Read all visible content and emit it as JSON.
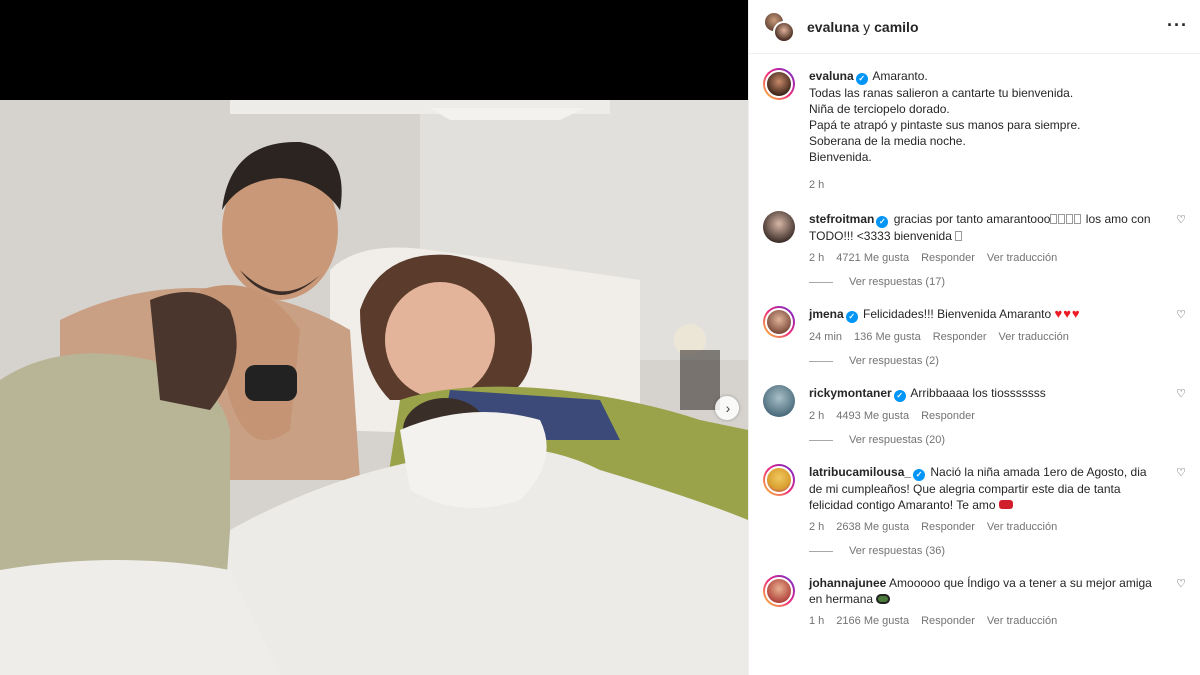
{
  "header": {
    "account_1": "evaluna",
    "joiner": "y",
    "account_2": "camilo"
  },
  "caption": {
    "username": "evaluna",
    "lines": [
      "Amaranto.",
      "Todas las ranas salieron a cantarte tu bienvenida.",
      "Niña de terciopelo dorado.",
      "Papá te atrapó y pintaste sus manos para siempre.",
      "Soberana de la media noche.",
      "Bienvenida."
    ],
    "time": "2 h"
  },
  "labels": {
    "reply": "Responder",
    "translate": "Ver traducción",
    "likes_suffix": "Me gusta"
  },
  "comments": [
    {
      "username": "stefroitman",
      "text": "gracias por tanto amarantooo",
      "text_2": "los amo con TODO!!! <3333 bienvenida",
      "time": "2 h",
      "likes": "4721",
      "replies": "Ver respuestas (17)",
      "avatar_color": "#3a2c28"
    },
    {
      "username": "jmena",
      "text": "Felicidades!!! Bienvenida Amaranto",
      "time": "24 min",
      "likes": "136",
      "replies": "Ver respuestas (2)",
      "avatar_color": "#7a4a3a"
    },
    {
      "username": "rickymontaner",
      "text": "Arribbaaaa los tiosssssss",
      "time": "2 h",
      "likes": "4493",
      "replies": "Ver respuestas (20)",
      "avatar_color": "#4a6a7a"
    },
    {
      "username": "latribucamilousa_",
      "text": "Nació la niña amada 1ero de Agosto, dia de mi cumpleaños! Que alegria compartir este dia de tanta felicidad contigo Amaranto! Te amo",
      "time": "2 h",
      "likes": "2638",
      "replies": "Ver respuestas (36)",
      "avatar_color": "#d9a030"
    },
    {
      "username": "johannajunee",
      "text": "Amooooo que Índigo va a tener a su mejor amiga en hermana",
      "time": "1 h",
      "likes": "2166",
      "avatar_color": "#b0403a"
    }
  ],
  "colors": {
    "verified": "#0095f6",
    "meta_text": "#737373",
    "heart_emoji": "#ed1c24"
  },
  "icons": {
    "more": "more-horizontal-icon",
    "like": "heart-outline-icon",
    "next": "chevron-right-icon",
    "verified": "verified-badge-icon"
  }
}
